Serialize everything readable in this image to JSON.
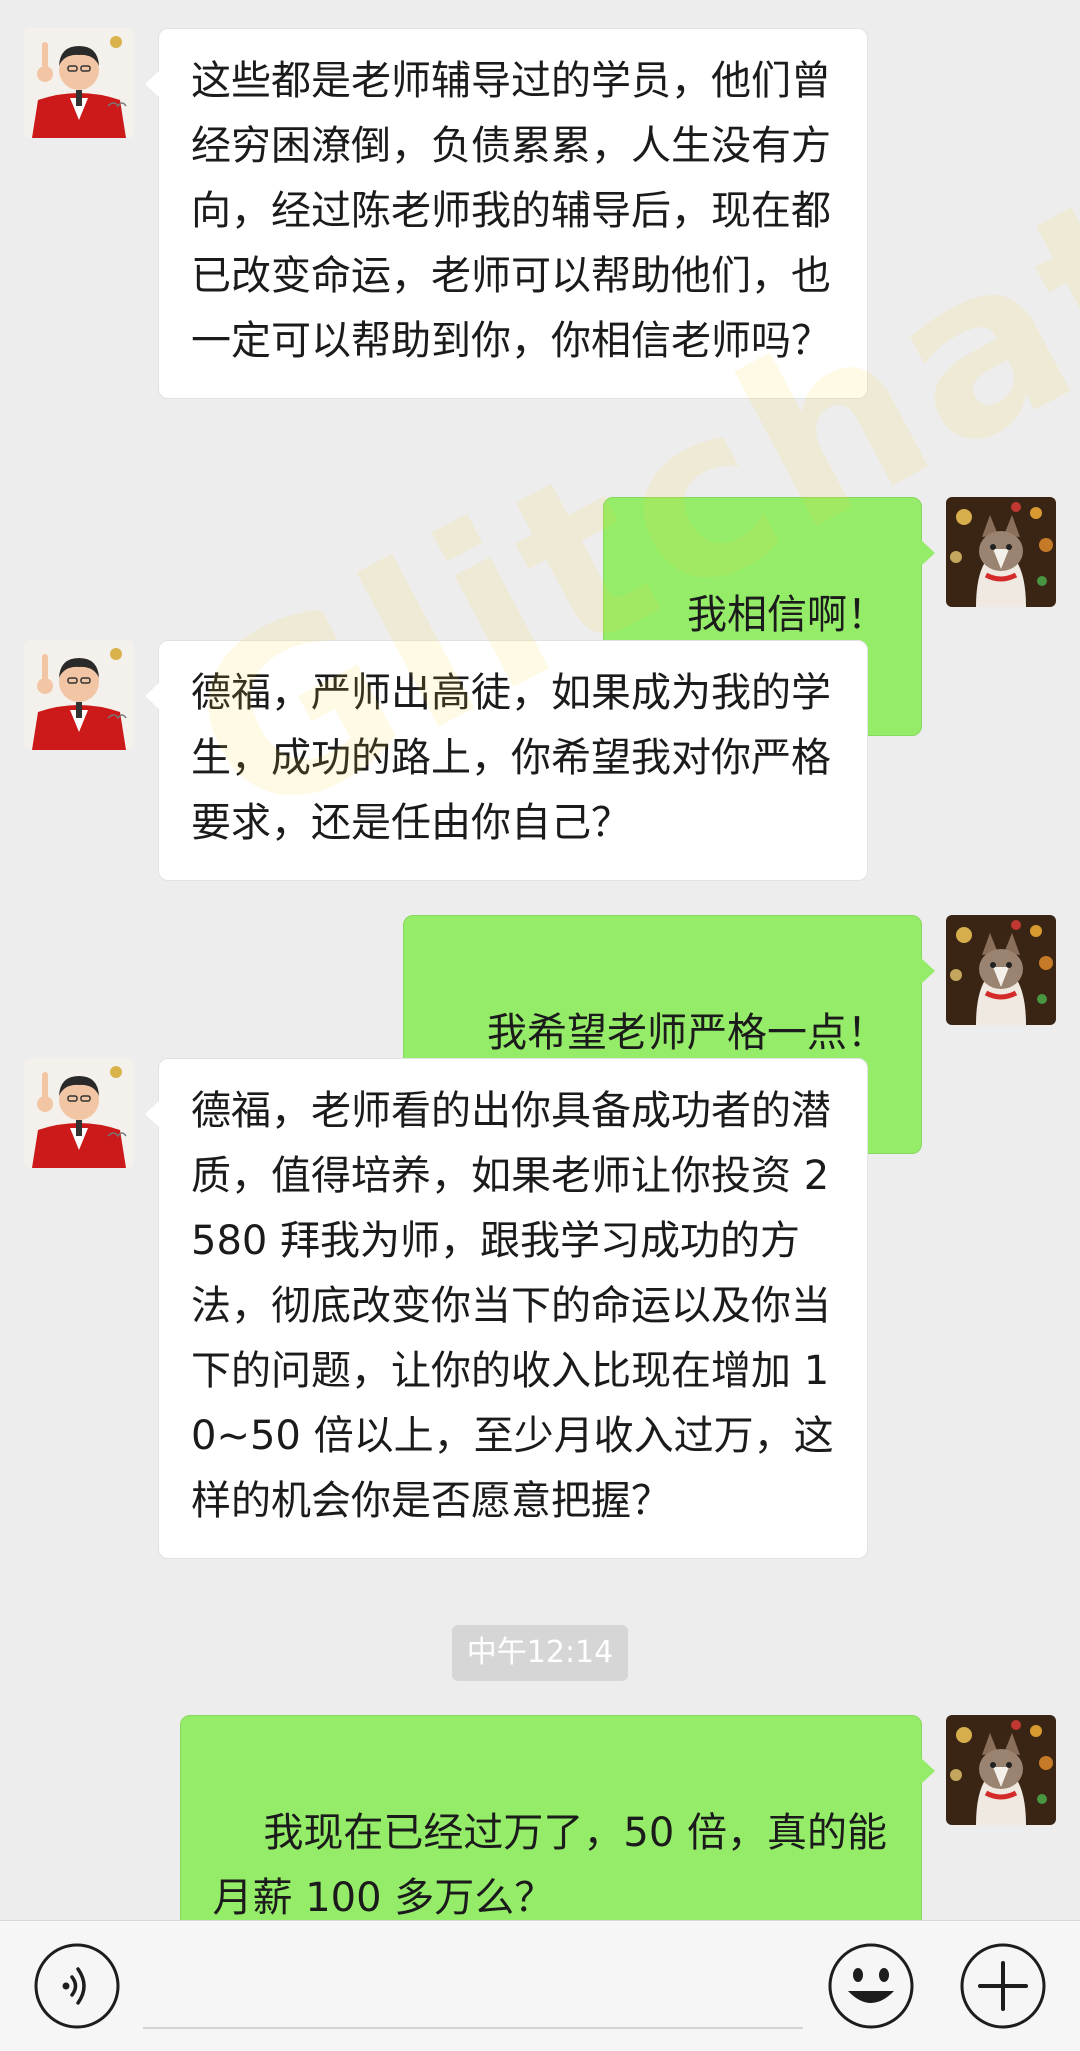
{
  "conversation": {
    "messages": [
      {
        "sender": "teacher",
        "text": "这些都是老师辅导过的学员，他们曾经穷困潦倒，负债累累，人生没有方向，经过陈老师我的辅导后，现在都已改变命运，老师可以帮助他们，也一定可以帮助到你，你相信老师吗？"
      },
      {
        "sender": "user",
        "text": "我相信啊！"
      },
      {
        "sender": "teacher",
        "text": "德福，严师出高徒，如果成为我的学生，成功的路上，你希望我对你严格要求，还是任由你自己？"
      },
      {
        "sender": "user",
        "text": "我希望老师严格一点！"
      },
      {
        "sender": "teacher",
        "text": "德福，老师看的出你具备成功者的潜质，值得培养，如果老师让你投资 2580 拜我为师，跟我学习成功的方法，彻底改变你当下的命运以及你当下的问题，让你的收入比现在增加 10~50 倍以上，至少月收入过万，这样的机会你是否愿意把握？"
      },
      {
        "sender": "user",
        "text": "我现在已经过万了，50 倍，真的能\n月薪 100 多万么？"
      }
    ],
    "timestamp": "中午12:14"
  },
  "watermark": "Glitchat",
  "input_bar": {
    "voice_icon": "voice-icon",
    "emoji_icon": "emoji-icon",
    "plus_icon": "plus-icon"
  },
  "colors": {
    "background": "#ededed",
    "incoming_bubble": "#ffffff",
    "outgoing_bubble": "#95ec69",
    "teacher_jacket": "#cc1a1a"
  }
}
